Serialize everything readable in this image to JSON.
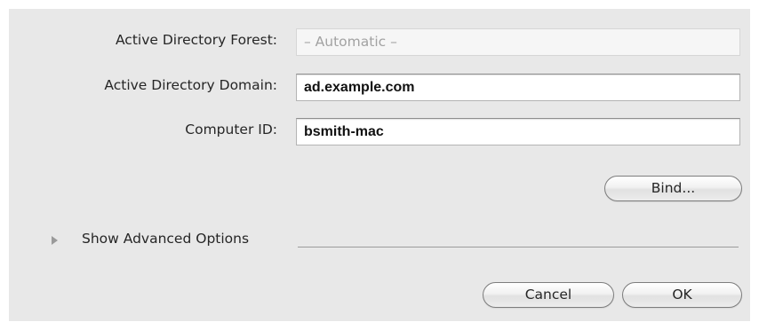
{
  "form": {
    "forest_label": "Active Directory Forest:",
    "forest_placeholder": "– Automatic –",
    "domain_label": "Active Directory Domain:",
    "domain_value": "ad.example.com",
    "computer_id_label": "Computer ID:",
    "computer_id_value": "bsmith-mac"
  },
  "buttons": {
    "bind": "Bind...",
    "cancel": "Cancel",
    "ok": "OK"
  },
  "advanced": {
    "label": "Show Advanced Options",
    "expanded": false,
    "icon": "disclosure-triangle-right-icon"
  }
}
